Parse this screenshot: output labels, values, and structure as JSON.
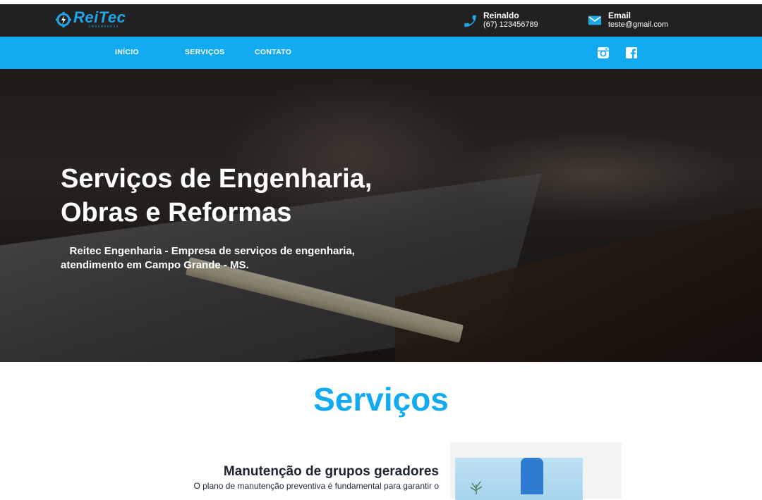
{
  "brand": {
    "name": "ReiTec",
    "subtitle": "ENGENHARIA",
    "color": "#1ea7e8"
  },
  "contacts": [
    {
      "icon": "phone-icon",
      "label": "Reinaldo",
      "value": "(67) 123456789"
    },
    {
      "icon": "mail-icon",
      "label": "Email",
      "value": "teste@gmail.com"
    }
  ],
  "nav": {
    "items": [
      {
        "label": "INÍCIO"
      },
      {
        "label": "SERVIÇOS"
      },
      {
        "label": "CONTATO"
      }
    ],
    "social": [
      "instagram-icon",
      "facebook-icon"
    ]
  },
  "hero": {
    "title_line1": "Serviços de Engenharia,",
    "title_line2": "Obras e Reformas",
    "subtitle_line1": "Reitec Engenharia - Empresa de serviços de engenharia,",
    "subtitle_line2": "atendimento em Campo Grande - MS."
  },
  "services": {
    "title": "Serviços",
    "items": [
      {
        "title": "Manutenção de grupos geradores",
        "description": "O plano de manutenção preventiva é fundamental para garantir o"
      }
    ]
  },
  "colors": {
    "topbar": "#212121",
    "navbar": "#12aaf0",
    "accent": "#12aaf0"
  }
}
